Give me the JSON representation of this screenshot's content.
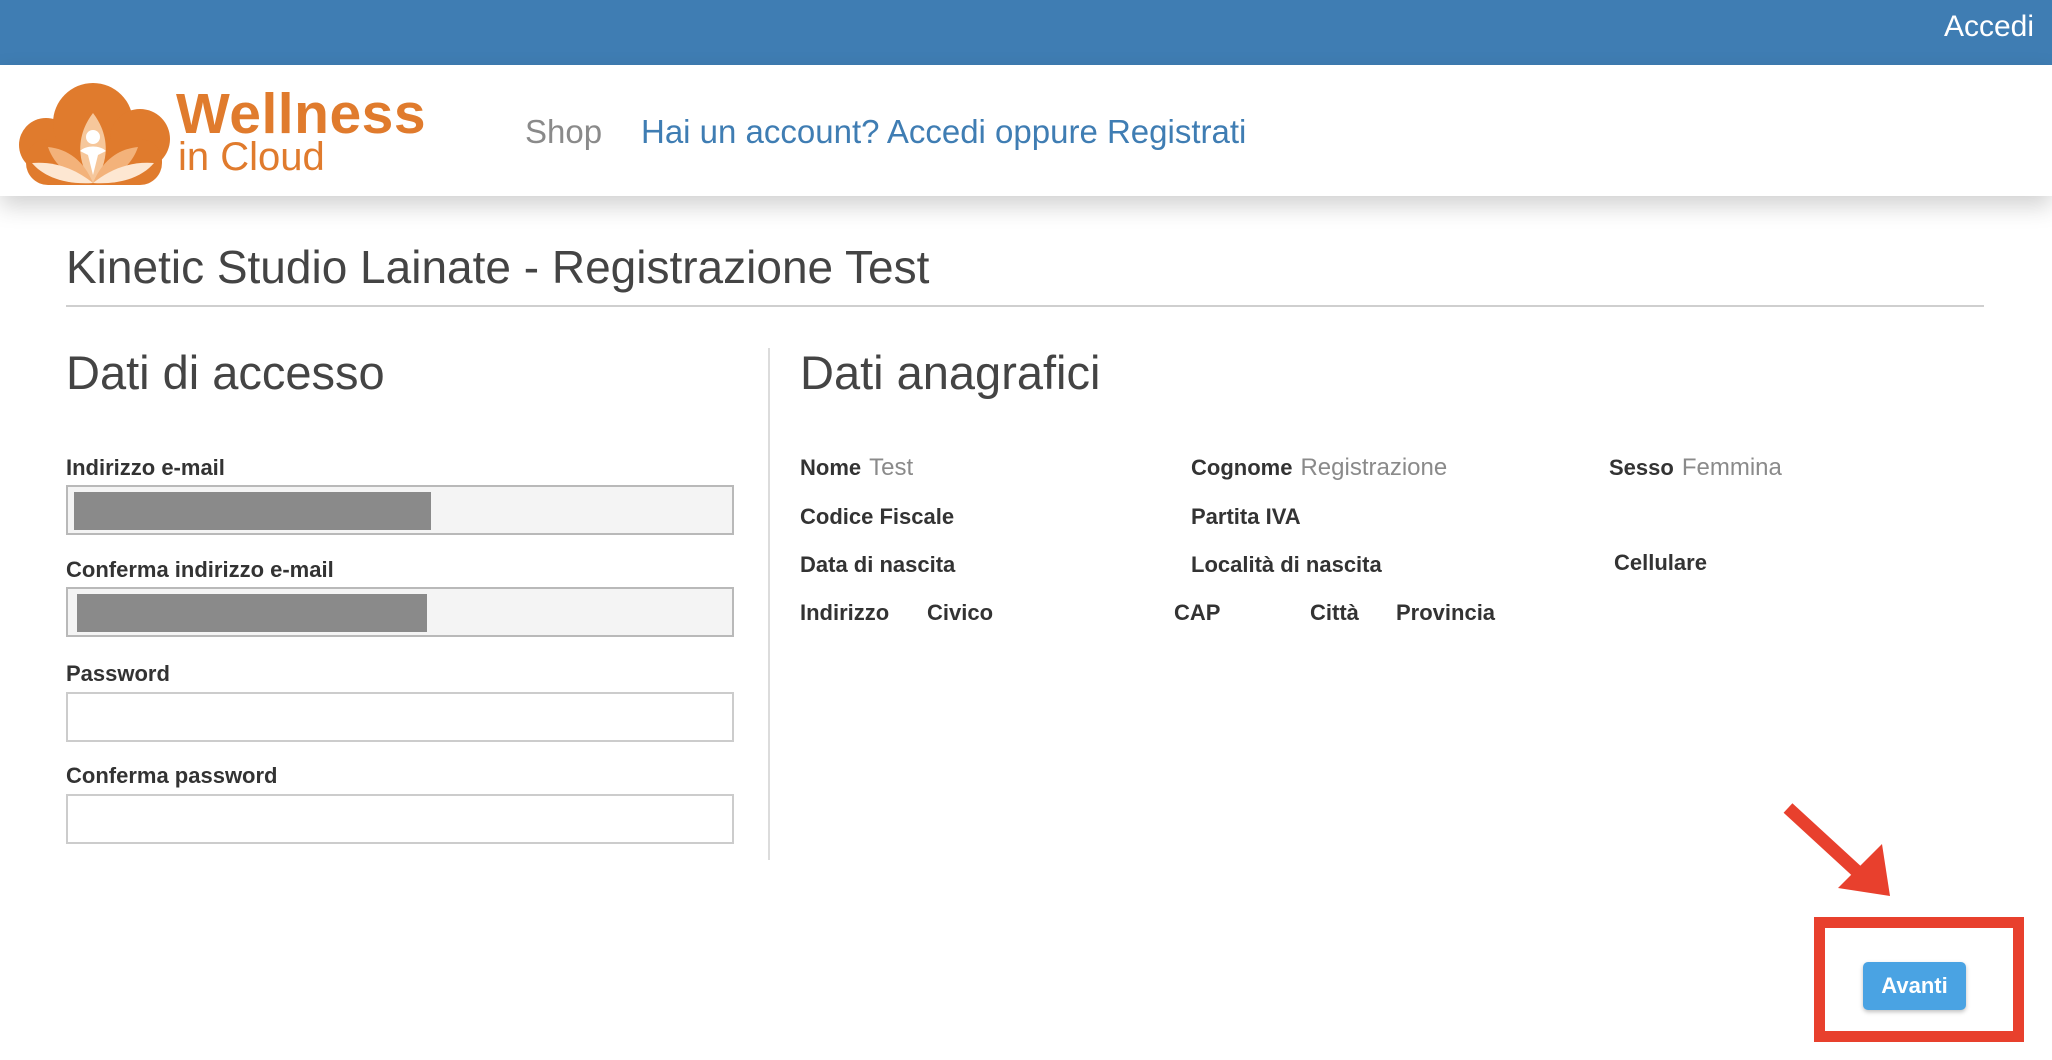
{
  "topbar": {
    "login_label": "Accedi",
    "color": "#3f7db3"
  },
  "header": {
    "logo": {
      "wordmark": "Wellness",
      "tagline": "in Cloud",
      "color": "#e07b2d"
    },
    "nav": {
      "shop_label": "Shop",
      "account_label": "Hai un account? Accedi oppure Registrati"
    }
  },
  "page": {
    "title": "Kinetic Studio Lainate - Registrazione Test"
  },
  "access": {
    "title": "Dati di accesso",
    "email_label": "Indirizzo e-mail",
    "email_value": "",
    "confirm_email_label": "Conferma indirizzo e-mail",
    "confirm_email_value": "",
    "password_label": "Password",
    "password_value": "",
    "confirm_password_label": "Conferma password",
    "confirm_password_value": ""
  },
  "personal": {
    "title": "Dati anagrafici",
    "nome_label": "Nome",
    "nome_value": "Test",
    "cognome_label": "Cognome",
    "cognome_value": "Registrazione",
    "sesso_label": "Sesso",
    "sesso_value": "Femmina",
    "codice_fiscale_label": "Codice Fiscale",
    "partita_iva_label": "Partita IVA",
    "data_nascita_label": "Data di nascita",
    "localita_nascita_label": "Località di nascita",
    "cellulare_label": "Cellulare",
    "indirizzo_label": "Indirizzo",
    "civico_label": "Civico",
    "cap_label": "CAP",
    "citta_label": "Città",
    "provincia_label": "Provincia"
  },
  "actions": {
    "next_label": "Avanti",
    "button_color": "#4aa3e3"
  },
  "annotation": {
    "color": "#e8402d"
  }
}
